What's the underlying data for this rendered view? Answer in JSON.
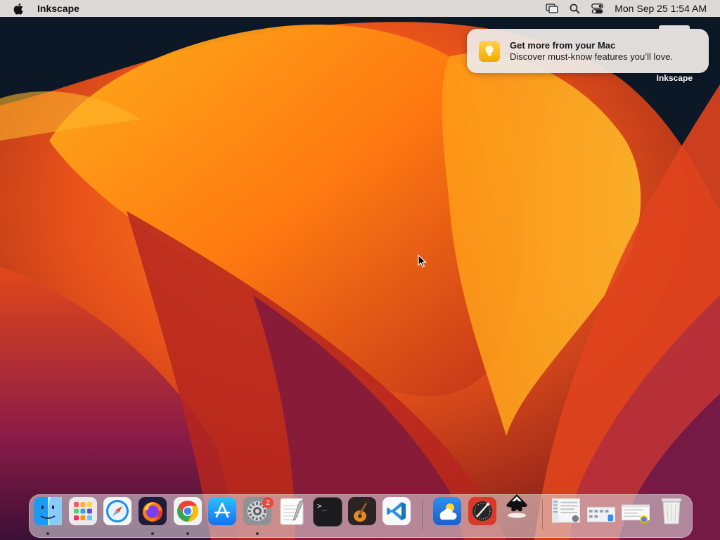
{
  "menubar": {
    "app_name": "Inkscape",
    "datetime": "Mon Sep 25  1:54 AM",
    "icons": [
      "apple-logo-icon",
      "screen-mirroring-icon",
      "spotlight-search-icon",
      "control-center-icon"
    ]
  },
  "notification": {
    "title": "Get more from your Mac",
    "body": "Discover must-know features you’ll love.",
    "icon": "lightbulb-icon"
  },
  "desktop": {
    "item_label": "Inkscape"
  },
  "dock": {
    "apps": [
      {
        "name": "Finder",
        "icon": "finder-icon",
        "running": true
      },
      {
        "name": "Launchpad",
        "icon": "launchpad-icon",
        "running": false
      },
      {
        "name": "Safari",
        "icon": "safari-icon",
        "running": false
      },
      {
        "name": "Firefox",
        "icon": "firefox-icon",
        "running": true
      },
      {
        "name": "Chrome",
        "icon": "chrome-icon",
        "running": true
      },
      {
        "name": "App Store",
        "icon": "app-store-icon",
        "running": false
      },
      {
        "name": "System Settings",
        "icon": "system-settings-icon",
        "running": true,
        "badge": "2"
      },
      {
        "name": "TextEdit",
        "icon": "textedit-icon",
        "running": false
      },
      {
        "name": "Terminal",
        "icon": "terminal-icon",
        "running": false
      },
      {
        "name": "GarageBand",
        "icon": "garageband-icon",
        "running": false
      },
      {
        "name": "Visual Studio Code",
        "icon": "vscode-icon",
        "running": false
      },
      {
        "name": "Weather",
        "icon": "weather-icon",
        "running": false
      },
      {
        "name": "Digital Color Meter",
        "icon": "color-meter-icon",
        "running": false
      },
      {
        "name": "Inkscape",
        "icon": "inkscape-icon",
        "running": false
      }
    ],
    "badge_count": "2",
    "terminal_prompt": ">_"
  },
  "colors": {
    "accent_orange": "#f47a1a",
    "badge_red": "#e9493b",
    "vscode_blue": "#2b8fe0"
  }
}
